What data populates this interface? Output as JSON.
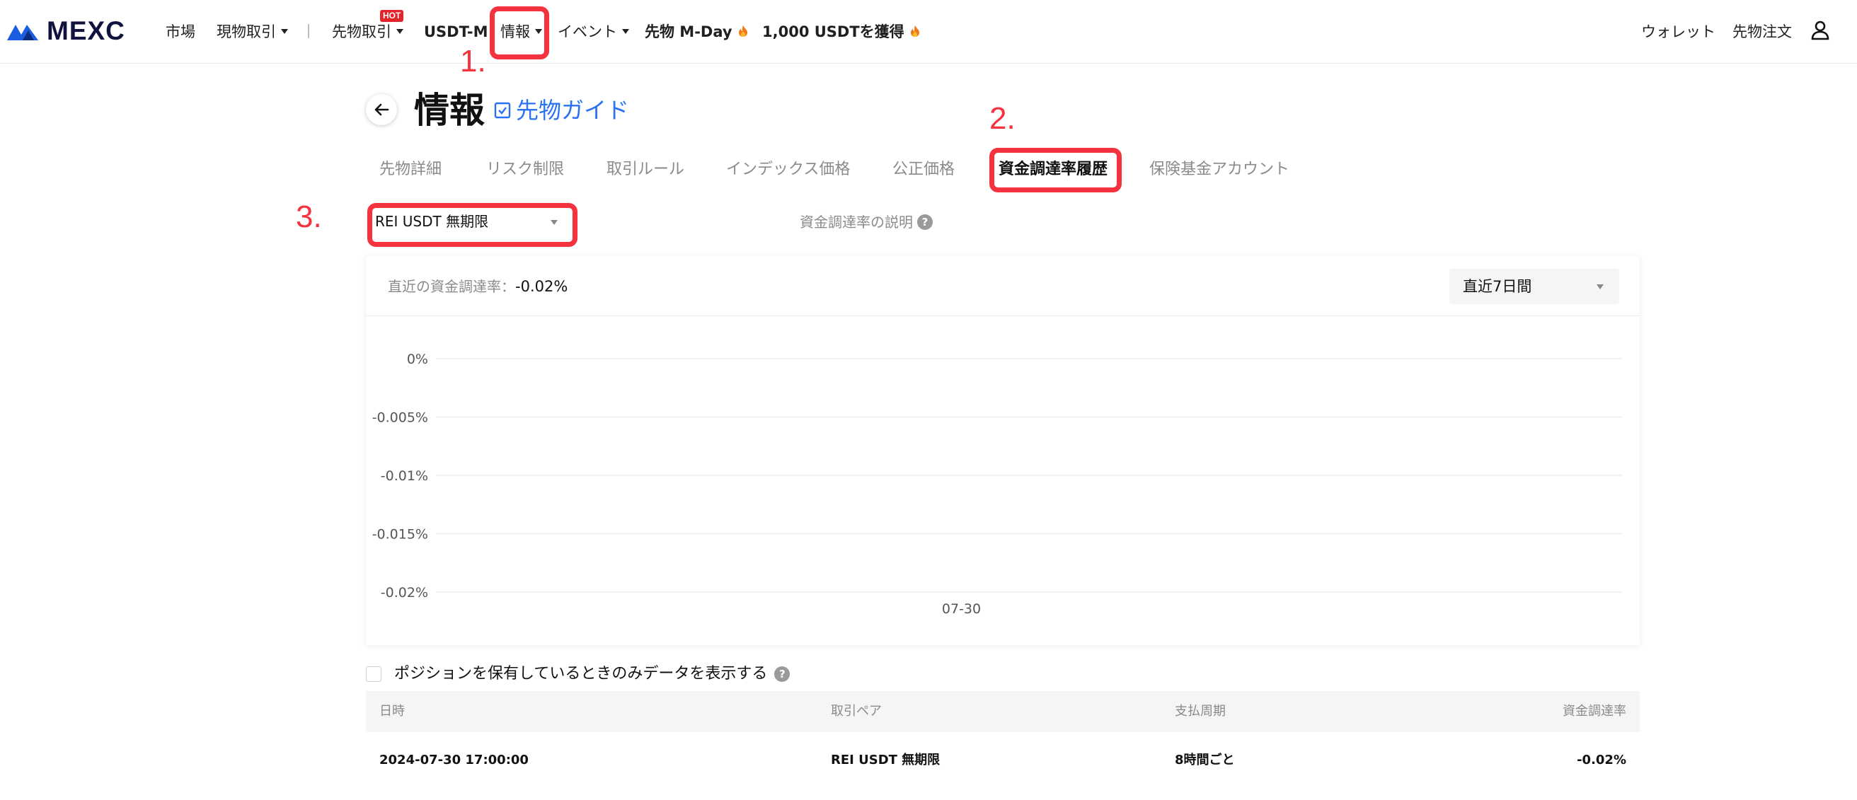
{
  "nav": {
    "brand": "MEXC",
    "items": {
      "market": "市場",
      "spot": "現物取引",
      "futures": "先物取引",
      "hot_badge": "HOT",
      "usdtm": "USDT-M",
      "info": "情報",
      "events": "イベント",
      "mday": "先物 M-Day",
      "earn": "1,000 USDTを獲得",
      "wallet": "ウォレット",
      "orders": "先物注文"
    }
  },
  "annotations": {
    "step1": "1.",
    "step2": "2.",
    "step3": "3.",
    "color": "#f4333e"
  },
  "header": {
    "title": "情報",
    "guide": "先物ガイド"
  },
  "tabs": [
    "先物詳細",
    "リスク制限",
    "取引ルール",
    "インデックス価格",
    "公正価格",
    "資金調達率履歴",
    "保険基金アカウント"
  ],
  "active_tab": "資金調達率履歴",
  "selector": {
    "symbol": "REI USDT 無期限",
    "explain": "資金調達率の説明",
    "help": "?"
  },
  "card": {
    "recent_label": "直近の資金調達率：",
    "recent_value": "-0.02%",
    "period": "直近7日間"
  },
  "chart_data": {
    "type": "line",
    "y_ticks": [
      "0%",
      "-0.005%",
      "-0.01%",
      "-0.015%",
      "-0.02%"
    ],
    "ylim": [
      -0.02,
      0
    ],
    "x_ticks": [
      "07-30"
    ],
    "series": [],
    "grid": true
  },
  "table": {
    "filter_label": "ポジションを保有しているときのみデータを表示する",
    "columns": [
      "日時",
      "取引ペア",
      "支払周期",
      "資金調達率"
    ],
    "rows": [
      [
        "2024-07-30 17:00:00",
        "REI USDT 無期限",
        "8時間ごと",
        "-0.02%"
      ]
    ]
  },
  "colors": {
    "accent": "#2a72f2",
    "brand": "#1b5de0",
    "annotation": "#f4333e"
  }
}
